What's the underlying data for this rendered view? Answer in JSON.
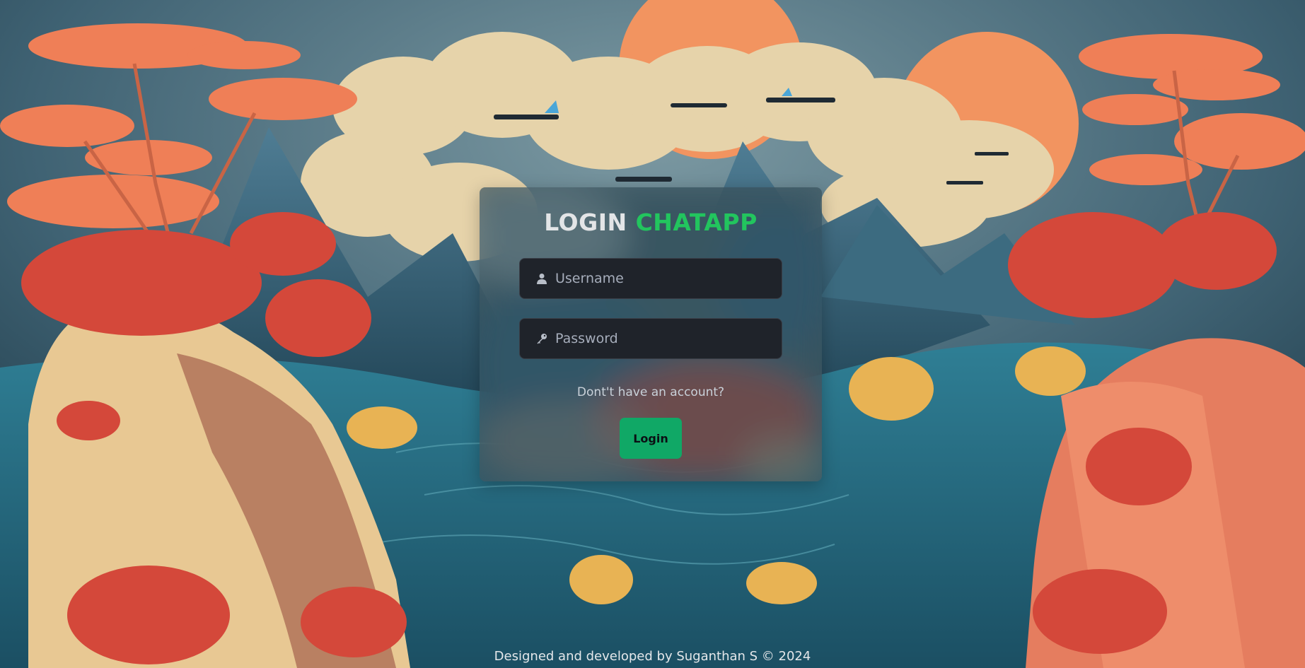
{
  "login": {
    "title_word1": "LOGIN",
    "title_word2": "CHATAPP",
    "username_placeholder": "Username",
    "password_placeholder": "Password",
    "signup_link": "Dont't have an account?",
    "login_button": "Login"
  },
  "footer": {
    "credit": "Designed and developed by Suganthan S © 2024"
  },
  "colors": {
    "accent": "#22c55e",
    "button": "#10a866",
    "input_bg": "#1f232a"
  },
  "icons": {
    "username": "user-icon",
    "password": "key-icon"
  }
}
